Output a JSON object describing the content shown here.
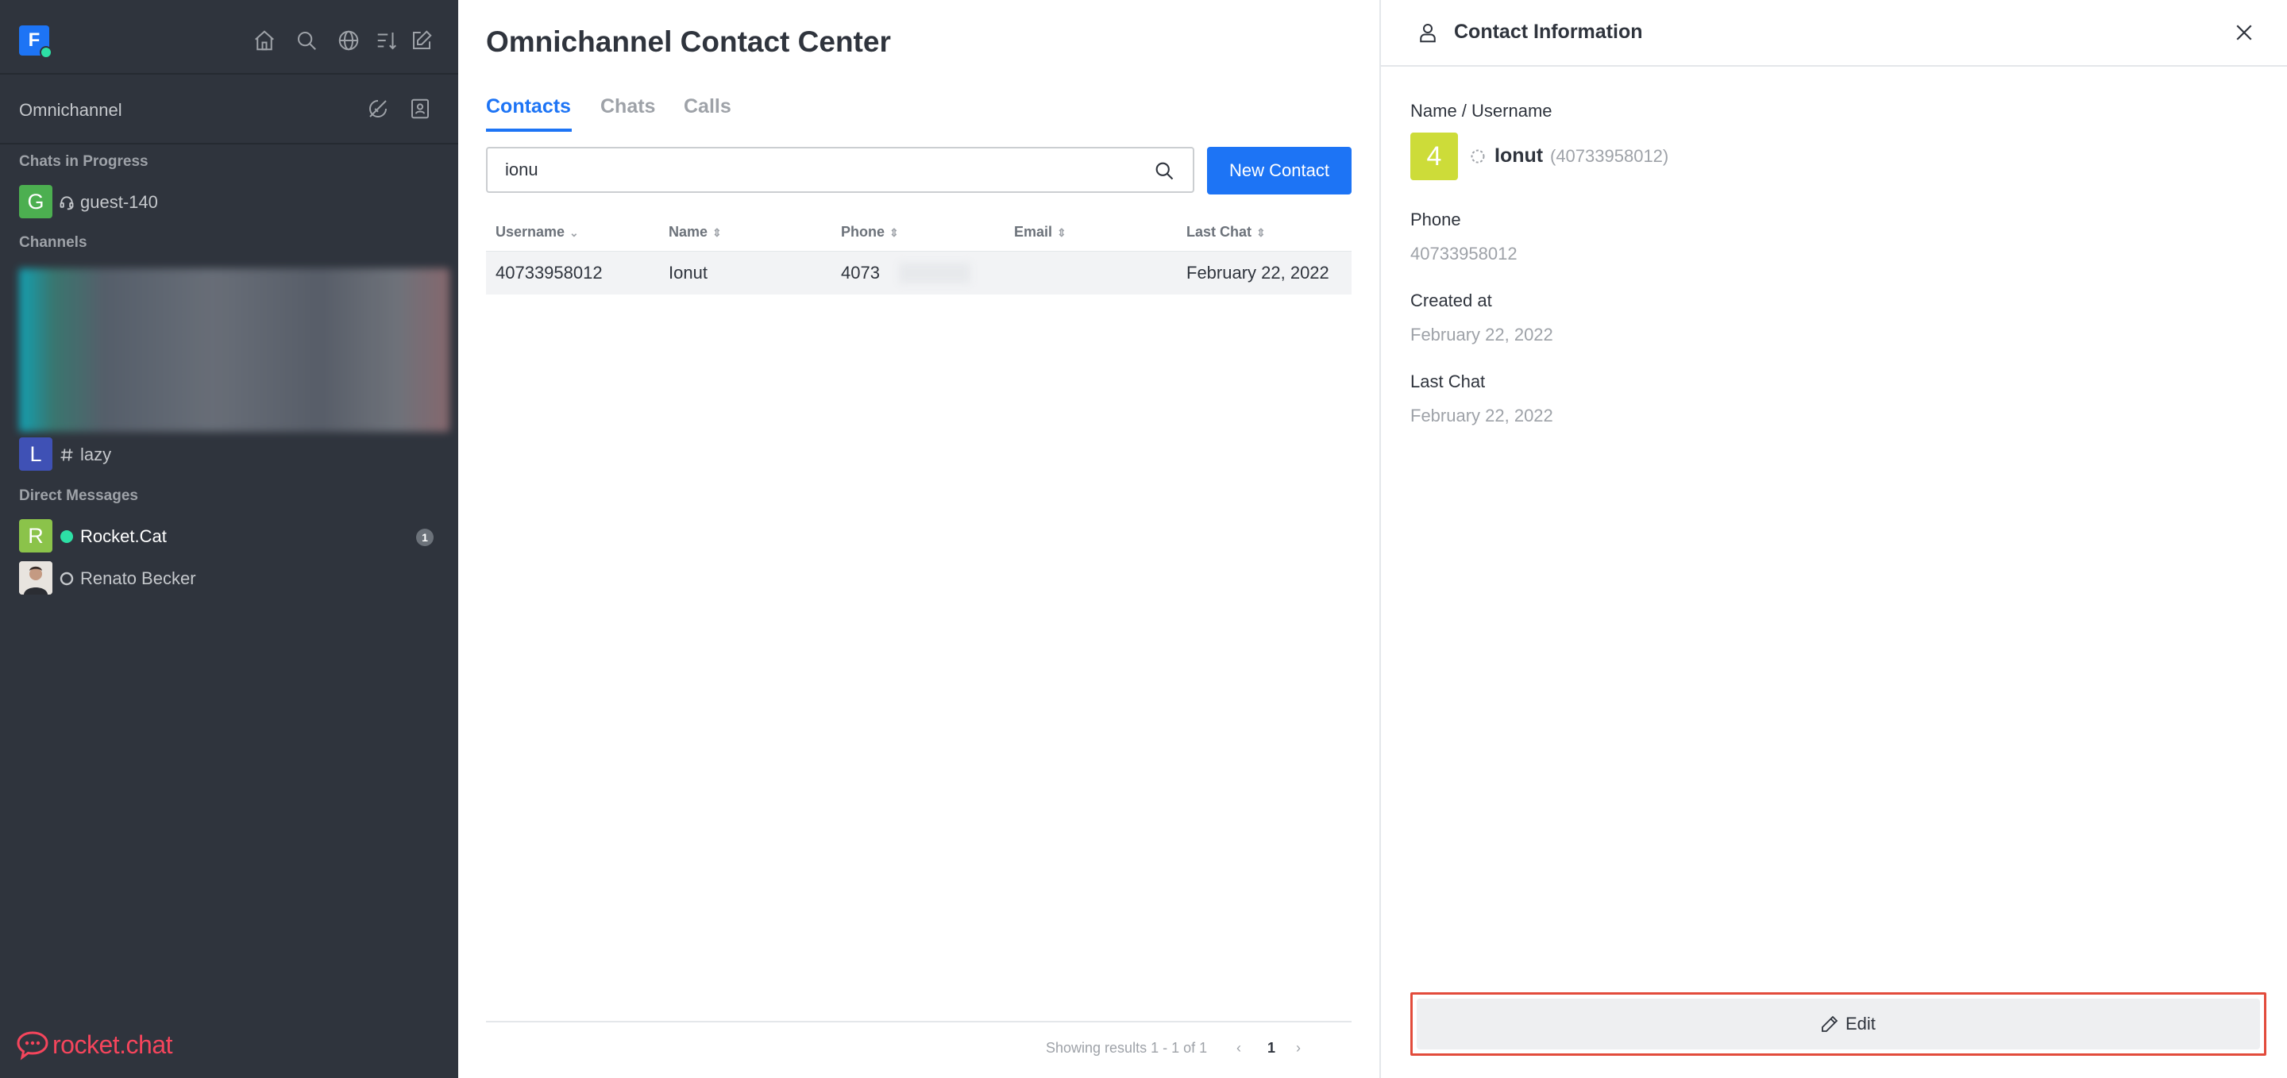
{
  "sidebar": {
    "workspace_initial": "F",
    "header_icons": [
      "home-icon",
      "search-icon",
      "directory-icon",
      "sort-icon",
      "create-new-icon"
    ],
    "omnichannel": {
      "title": "Omnichannel",
      "icons": [
        "omnichannel-status-icon",
        "contact-center-icon"
      ]
    },
    "sections": {
      "chats_in_progress": "Chats in Progress",
      "channels": "Channels",
      "direct_messages": "Direct Messages"
    },
    "chats_in_progress": [
      {
        "initial": "G",
        "label": "guest-140",
        "avatar_color": "#4caf50",
        "icon": "headset-icon"
      }
    ],
    "channels": [
      {
        "initial": "L",
        "label": "lazy",
        "avatar_color": "#3f51b5",
        "icon": "hashtag-icon"
      }
    ],
    "direct_messages": [
      {
        "initial": "R",
        "label": "Rocket.Cat",
        "avatar_color": "#8bc34a",
        "status": "online",
        "badge": "1"
      },
      {
        "label": "Renato Becker",
        "status": "offline"
      }
    ],
    "brand": "rocket.chat"
  },
  "main": {
    "title": "Omnichannel Contact Center",
    "tabs": [
      {
        "label": "Contacts",
        "active": true
      },
      {
        "label": "Chats",
        "active": false
      },
      {
        "label": "Calls",
        "active": false
      }
    ],
    "search": {
      "value": "ionu"
    },
    "new_contact_label": "New Contact",
    "table": {
      "columns": [
        "Username",
        "Name",
        "Phone",
        "Email",
        "Last Chat"
      ],
      "rows": [
        {
          "username": "40733958012",
          "name": "Ionut",
          "phone": "4073",
          "email": "",
          "last_chat": "February 22, 2022"
        }
      ]
    },
    "pagination": {
      "summary": "Showing results 1 - 1 of 1",
      "current_page": "1",
      "prev": "‹",
      "next": "›"
    }
  },
  "contact_info": {
    "title": "Contact Information",
    "name_label": "Name / Username",
    "avatar_initial": "4",
    "avatar_color": "#cddc39",
    "name": "Ionut",
    "username": "(40733958012)",
    "phone_label": "Phone",
    "phone": "40733958012",
    "created_label": "Created at",
    "created": "February 22, 2022",
    "last_chat_label": "Last Chat",
    "last_chat": "February 22, 2022",
    "edit_label": "Edit"
  },
  "colors": {
    "accent": "#1d74f5",
    "sidebar_bg": "#2f343d",
    "highlight": "#e24b3b",
    "online": "#2de0a5"
  }
}
